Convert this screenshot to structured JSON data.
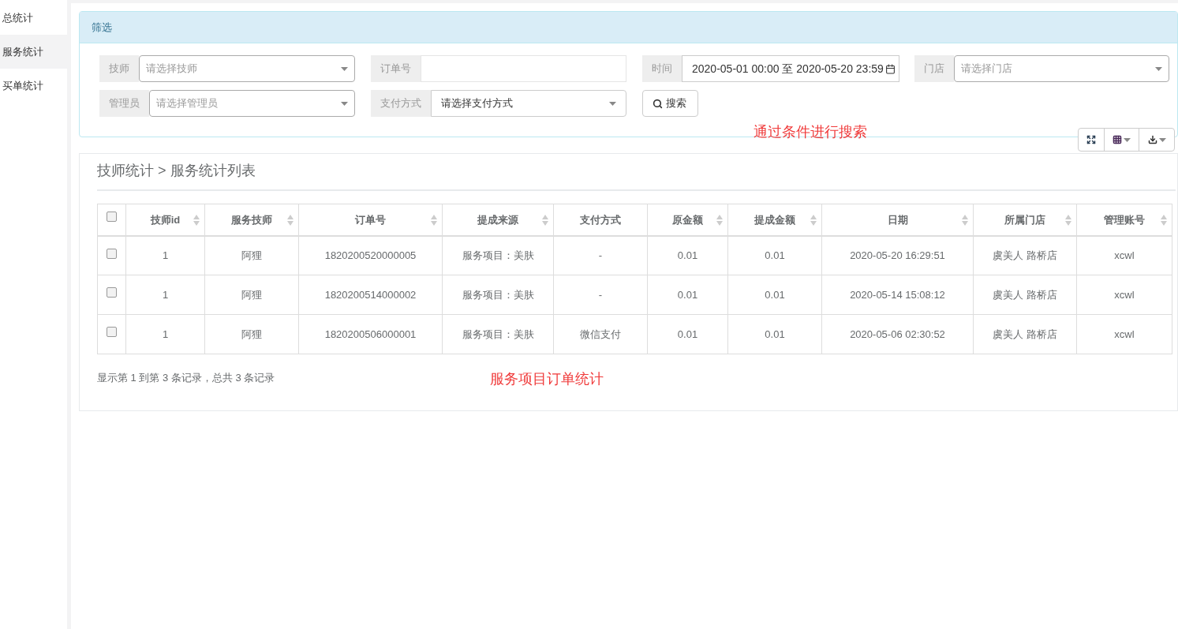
{
  "sidebar": {
    "items": [
      {
        "label": "总统计",
        "selected": false
      },
      {
        "label": "服务统计",
        "selected": true
      },
      {
        "label": "买单统计",
        "selected": false
      }
    ]
  },
  "filter": {
    "title": "筛选",
    "rows": [
      [
        {
          "kind": "select",
          "label": "技师",
          "placeholder": "请选择技师"
        },
        {
          "kind": "input",
          "label": "订单号"
        },
        {
          "kind": "daterange",
          "label": "时间",
          "value": "2020-05-01 00:00 至 2020-05-20 23:59"
        },
        {
          "kind": "select",
          "label": "门店",
          "placeholder": "请选择门店"
        }
      ],
      [
        {
          "kind": "select",
          "label": "管理员",
          "placeholder": "请选择管理员"
        },
        {
          "kind": "choice",
          "label": "支付方式",
          "value": "请选择支付方式"
        },
        {
          "kind": "button",
          "label": "搜索"
        }
      ]
    ],
    "note": "通过条件进行搜索"
  },
  "table_panel": {
    "title": "技师统计 > 服务统计列表",
    "header_checkbox": {
      "checked": false
    },
    "columns": [
      {
        "label": "技师id",
        "sortable": true
      },
      {
        "label": "服务技师",
        "sortable": true
      },
      {
        "label": "订单号",
        "sortable": true
      },
      {
        "label": "提成来源",
        "sortable": true
      },
      {
        "label": "支付方式",
        "sortable": false
      },
      {
        "label": "原金额",
        "sortable": true
      },
      {
        "label": "提成金额",
        "sortable": true
      },
      {
        "label": "日期",
        "sortable": true
      },
      {
        "label": "所属门店",
        "sortable": true
      },
      {
        "label": "管理账号",
        "sortable": true
      }
    ],
    "rows": [
      {
        "checked": false,
        "cells": [
          "1",
          "阿狸",
          "1820200520000005",
          "服务项目：美肤",
          "-",
          "0.01",
          "0.01",
          "2020-05-20 16:29:51",
          "虞美人 路桥店",
          "xcwl"
        ]
      },
      {
        "checked": false,
        "cells": [
          "1",
          "阿狸",
          "1820200514000002",
          "服务项目：美肤",
          "-",
          "0.01",
          "0.01",
          "2020-05-14 15:08:12",
          "虞美人 路桥店",
          "xcwl"
        ]
      },
      {
        "checked": false,
        "cells": [
          "1",
          "阿狸",
          "1820200506000001",
          "服务项目：美肤",
          "微信支付",
          "0.01",
          "0.01",
          "2020-05-06 02:30:52",
          "虞美人 路桥店",
          "xcwl"
        ]
      }
    ],
    "footer": "显示第 1 到第 3 条记录，总共 3 条记录",
    "note": "服务项目订单统计"
  }
}
